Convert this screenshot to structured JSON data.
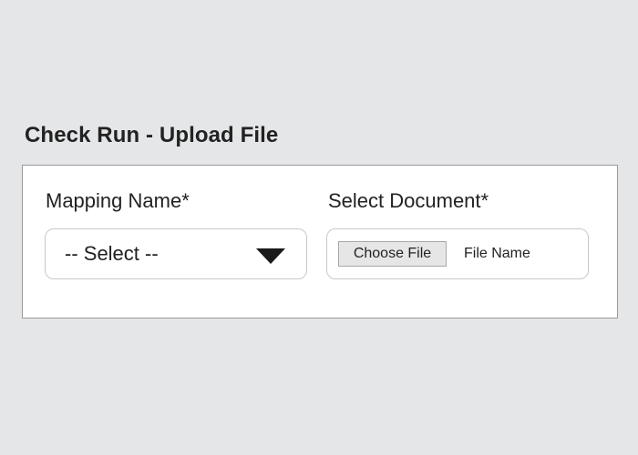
{
  "page": {
    "title": "Check Run - Upload File"
  },
  "form": {
    "mapping": {
      "label": "Mapping Name*",
      "selected_value": "-- Select --",
      "icon": "chevron-down-icon"
    },
    "document": {
      "label": "Select Document*",
      "button_label": "Choose File",
      "file_name": "File Name"
    }
  },
  "colors": {
    "background": "#e5e6e8",
    "panel": "#ffffff",
    "panel_border": "#9a9a9a",
    "button_bg": "#e6e6e6",
    "text": "#222222"
  }
}
